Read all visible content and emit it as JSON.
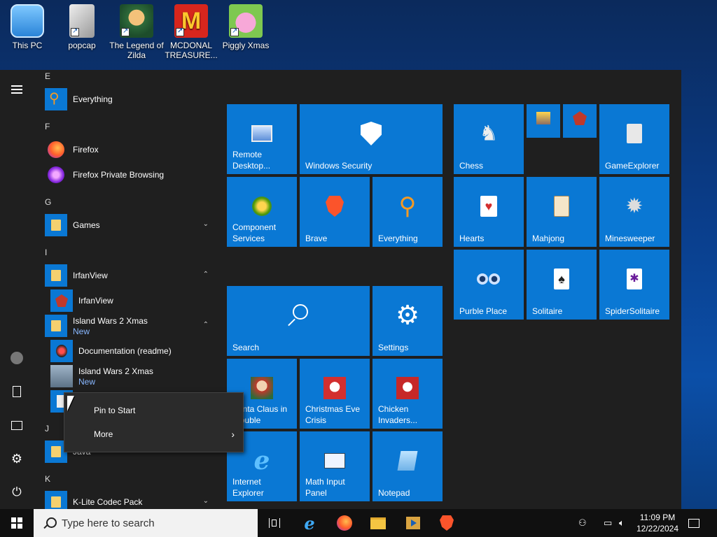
{
  "desktop": {
    "icons": [
      {
        "label": "This PC",
        "icon": "computer-icon"
      },
      {
        "label": "popcap",
        "icon": "document-icon"
      },
      {
        "label": "The Legend of Zilda",
        "icon": "game-icon"
      },
      {
        "label": "MCDONAL TREASURE...",
        "icon": "mcdonalds-icon"
      },
      {
        "label": "Piggly Xmas",
        "icon": "pig-icon"
      }
    ]
  },
  "start_menu": {
    "letters": [
      "E",
      "F",
      "G",
      "I",
      "J",
      "K"
    ],
    "apps": {
      "everything": "Everything",
      "firefox": "Firefox",
      "firefox_private": "Firefox Private Browsing",
      "games": "Games",
      "irfanview_folder": "IrfanView",
      "irfanview": "IrfanView",
      "island_wars_folder": "Island Wars 2 Xmas",
      "island_wars_folder_badge": "New",
      "documentation": "Documentation (readme)",
      "island_wars_app": "Island Wars 2 Xmas",
      "island_wars_app_badge": "New",
      "java": "Java",
      "klite": "K-Lite Codec Pack"
    },
    "tiles": {
      "remote_desktop": "Remote Desktop...",
      "windows_security": "Windows Security",
      "component_services": "Component Services",
      "brave": "Brave",
      "everything": "Everything",
      "search": "Search",
      "settings": "Settings",
      "santa": "Santa Claus in Trouble",
      "christmas": "Christmas Eve Crisis",
      "chicken": "Chicken Invaders...",
      "ie": "Internet Explorer",
      "math": "Math Input Panel",
      "notepad": "Notepad",
      "chess": "Chess",
      "gameexplorer": "GameExplorer",
      "hearts": "Hearts",
      "mahjong": "Mahjong",
      "minesweeper": "Minesweeper",
      "purble": "Purble Place",
      "solitaire": "Solitaire",
      "spider": "SpiderSolitaire"
    }
  },
  "context_menu": {
    "pin": "Pin to Start",
    "more": "More"
  },
  "taskbar": {
    "search_placeholder": "Type here to search",
    "time": "11:09 PM",
    "date": "12/22/2024"
  },
  "colors": {
    "tile_blue": "#0a78d4",
    "menu_bg": "#1f1f1f",
    "taskbar_bg": "#101010"
  }
}
